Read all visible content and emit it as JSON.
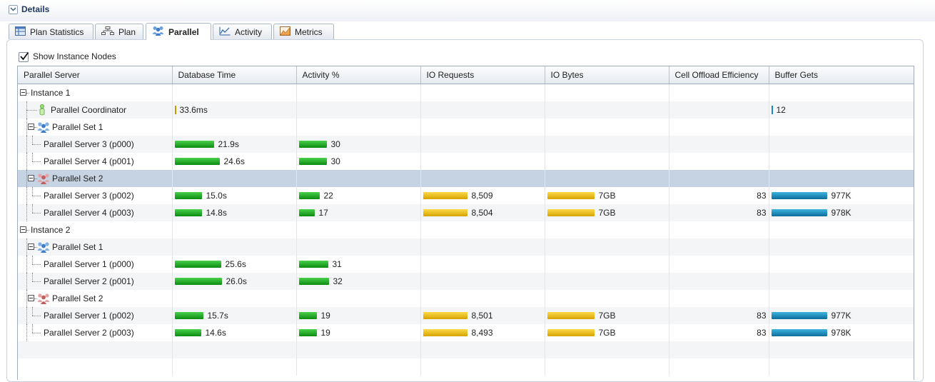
{
  "details": {
    "title": "Details"
  },
  "tabs": [
    {
      "label": "Plan Statistics",
      "icon": "table-icon",
      "active": false
    },
    {
      "label": "Plan",
      "icon": "plan-tree-icon",
      "active": false
    },
    {
      "label": "Parallel",
      "icon": "people-icon",
      "active": true
    },
    {
      "label": "Activity",
      "icon": "line-chart-icon",
      "active": false
    },
    {
      "label": "Metrics",
      "icon": "metrics-icon",
      "active": false
    }
  ],
  "show_instance_nodes": {
    "label": "Show Instance Nodes",
    "checked": true
  },
  "columns": [
    "Parallel Server",
    "Database Time",
    "Activity %",
    "IO Requests",
    "IO Bytes",
    "Cell Offload Efficiency",
    "Buffer Gets"
  ],
  "rows": [
    {
      "kind": "instance",
      "level": 0,
      "name": "Instance 1"
    },
    {
      "kind": "coordinator",
      "level": 1,
      "name": "Parallel Coordinator",
      "db_time": "33.6ms",
      "db_time_frac": 0.003,
      "buffer_gets": "12",
      "buffer_gets_frac": 0.0
    },
    {
      "kind": "set",
      "level": 1,
      "name": "Parallel Set 1",
      "set_color": "blue"
    },
    {
      "kind": "server",
      "level": 2,
      "name": "Parallel Server 3 (p000)",
      "db_time": "21.9s",
      "db_time_frac": 0.84,
      "activity": "30",
      "activity_frac": 0.94
    },
    {
      "kind": "server",
      "level": 2,
      "name": "Parallel Server 4 (p001)",
      "db_time": "24.6s",
      "db_time_frac": 0.95,
      "activity": "30",
      "activity_frac": 0.94
    },
    {
      "kind": "set",
      "level": 1,
      "name": "Parallel Set 2",
      "set_color": "red",
      "selected": true
    },
    {
      "kind": "server",
      "level": 2,
      "name": "Parallel Server 3 (p002)",
      "db_time": "15.0s",
      "db_time_frac": 0.58,
      "activity": "22",
      "activity_frac": 0.69,
      "io_requests": "8,509",
      "io_requests_frac": 1.0,
      "io_bytes": "7GB",
      "io_bytes_frac": 1.0,
      "cell_offload": "83",
      "buffer_gets": "977K",
      "buffer_gets_frac": 1.0
    },
    {
      "kind": "server",
      "level": 2,
      "name": "Parallel Server 4 (p003)",
      "db_time": "14.8s",
      "db_time_frac": 0.57,
      "activity": "17",
      "activity_frac": 0.53,
      "io_requests": "8,504",
      "io_requests_frac": 1.0,
      "io_bytes": "7GB",
      "io_bytes_frac": 1.0,
      "cell_offload": "83",
      "buffer_gets": "978K",
      "buffer_gets_frac": 1.0
    },
    {
      "kind": "instance",
      "level": 0,
      "name": "Instance 2"
    },
    {
      "kind": "set",
      "level": 1,
      "name": "Parallel Set 1",
      "set_color": "blue"
    },
    {
      "kind": "server",
      "level": 2,
      "name": "Parallel Server 1 (p000)",
      "db_time": "25.6s",
      "db_time_frac": 0.98,
      "activity": "31",
      "activity_frac": 0.97
    },
    {
      "kind": "server",
      "level": 2,
      "name": "Parallel Server 2 (p001)",
      "db_time": "26.0s",
      "db_time_frac": 1.0,
      "activity": "32",
      "activity_frac": 1.0
    },
    {
      "kind": "set",
      "level": 1,
      "name": "Parallel Set 2",
      "set_color": "red"
    },
    {
      "kind": "server",
      "level": 2,
      "name": "Parallel Server 1 (p002)",
      "db_time": "15.7s",
      "db_time_frac": 0.6,
      "activity": "19",
      "activity_frac": 0.59,
      "io_requests": "8,501",
      "io_requests_frac": 1.0,
      "io_bytes": "7GB",
      "io_bytes_frac": 1.0,
      "cell_offload": "83",
      "buffer_gets": "977K",
      "buffer_gets_frac": 1.0
    },
    {
      "kind": "server",
      "level": 2,
      "name": "Parallel Server 2 (p003)",
      "db_time": "14.6s",
      "db_time_frac": 0.56,
      "activity": "19",
      "activity_frac": 0.59,
      "io_requests": "8,493",
      "io_requests_frac": 1.0,
      "io_bytes": "7GB",
      "io_bytes_frac": 1.0,
      "cell_offload": "83",
      "buffer_gets": "978K",
      "buffer_gets_frac": 1.0
    },
    {
      "kind": "empty"
    },
    {
      "kind": "empty"
    }
  ]
}
